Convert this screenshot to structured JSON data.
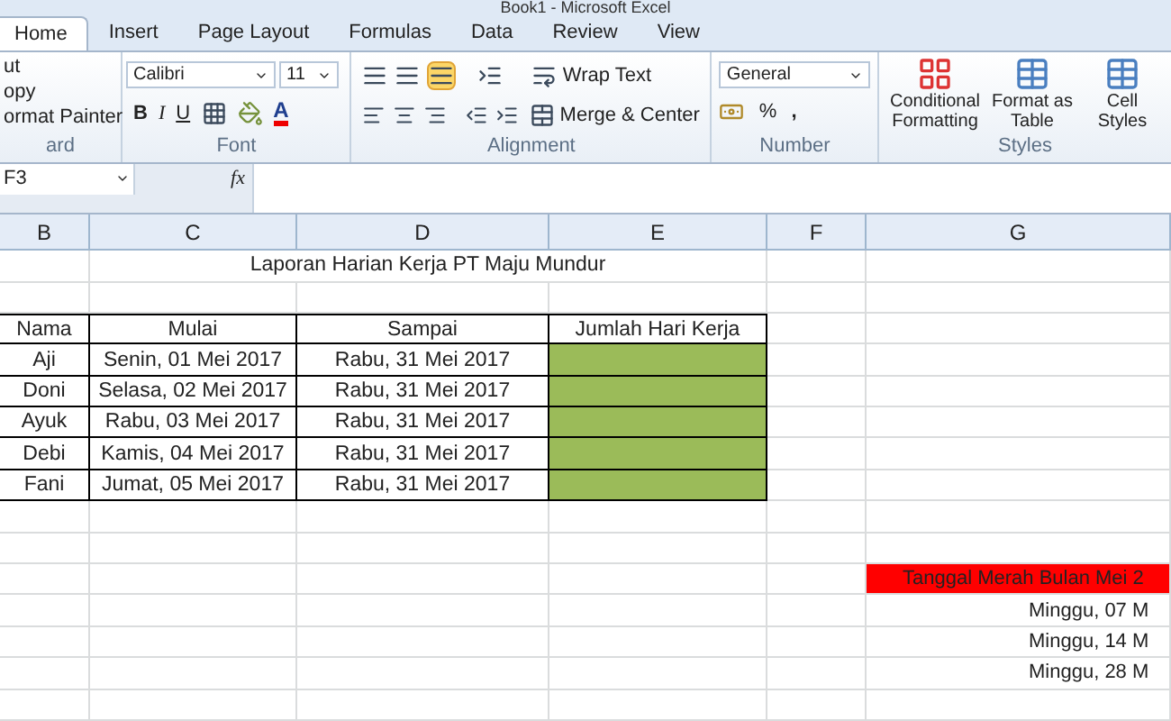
{
  "window": {
    "title": "Book1 - Microsoft Excel"
  },
  "tabs": [
    {
      "label": "Home",
      "selected": true
    },
    {
      "label": "Insert",
      "selected": false
    },
    {
      "label": "Page Layout",
      "selected": false
    },
    {
      "label": "Formulas",
      "selected": false
    },
    {
      "label": "Data",
      "selected": false
    },
    {
      "label": "Review",
      "selected": false
    },
    {
      "label": "View",
      "selected": false
    }
  ],
  "ribbon": {
    "clipboard": {
      "items": [
        "ut",
        "opy",
        "ormat Painter"
      ],
      "label": "ard"
    },
    "font": {
      "name": "Calibri",
      "size": "11",
      "bold": "B",
      "italic": "I",
      "underline": "U",
      "color_letter": "A",
      "label": "Font"
    },
    "alignment": {
      "wrap": "Wrap Text",
      "merge": "Merge & Center",
      "label": "Alignment"
    },
    "number": {
      "format": "General",
      "percent": "%",
      "comma": ",",
      "label": "Number"
    },
    "styles": {
      "items": [
        "Conditional Formatting",
        "Format as Table",
        "Cell Styles"
      ],
      "label": "Styles"
    }
  },
  "formula_bar": {
    "name_box": "F3",
    "fx": "fx"
  },
  "sheet": {
    "columns": [
      "B",
      "C",
      "D",
      "E",
      "F",
      "G"
    ],
    "title": "Laporan Harian Kerja PT Maju Mundur",
    "headers": [
      "Nama",
      "Mulai",
      "Sampai",
      "Jumlah Hari Kerja"
    ],
    "rows": [
      {
        "name": "Aji",
        "start": "Senin, 01 Mei 2017",
        "end": "Rabu, 31 Mei 2017",
        "highlighted": true
      },
      {
        "name": "Doni",
        "start": "Selasa, 02 Mei 2017",
        "end": "Rabu, 31 Mei 2017",
        "highlighted": true
      },
      {
        "name": "Ayuk",
        "start": "Rabu, 03 Mei 2017",
        "end": "Rabu, 31 Mei 2017",
        "highlighted": true
      },
      {
        "name": "Debi",
        "start": "Kamis, 04 Mei 2017",
        "end": "Rabu, 31 Mei 2017",
        "highlighted": true
      },
      {
        "name": "Fani",
        "start": "Jumat, 05 Mei 2017",
        "end": "Rabu, 31 Mei 2017",
        "highlighted": true
      }
    ],
    "holidays": {
      "title": "Tanggal Merah Bulan Mei 2",
      "highlighted": true,
      "items": [
        "Minggu, 07 M",
        "Minggu, 14 M",
        "Minggu, 28 M"
      ]
    }
  }
}
